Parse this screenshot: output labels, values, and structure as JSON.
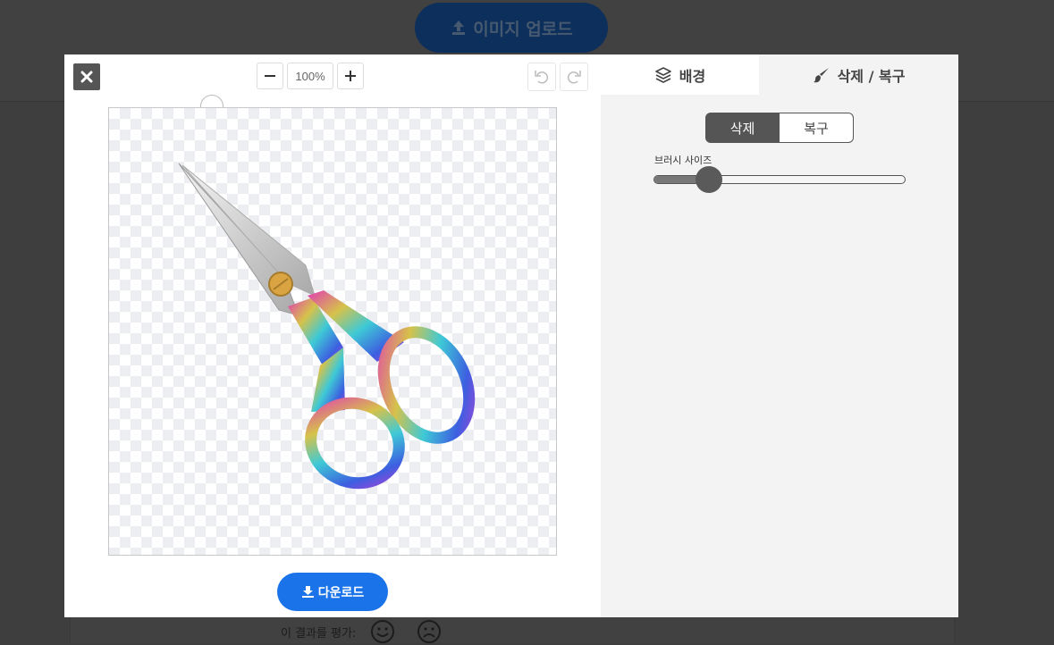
{
  "background": {
    "upload_label": "이미지 업로드",
    "rate_label": "이 결과를 평가:"
  },
  "editor": {
    "zoom_value": "100%",
    "download_label": "다운로드"
  },
  "side": {
    "tabs": [
      {
        "label": "배경",
        "icon": "layers-icon"
      },
      {
        "label": "삭제 / 복구",
        "icon": "brush-icon"
      }
    ],
    "mode_erase": "삭제",
    "mode_restore": "복구",
    "active_mode": "삭제",
    "brush_label": "브러시 사이즈",
    "brush_size_fraction": 0.22
  },
  "colors": {
    "accent": "#1a73e8",
    "active_mode": "#555555",
    "overlay": "#3d3e3d"
  }
}
